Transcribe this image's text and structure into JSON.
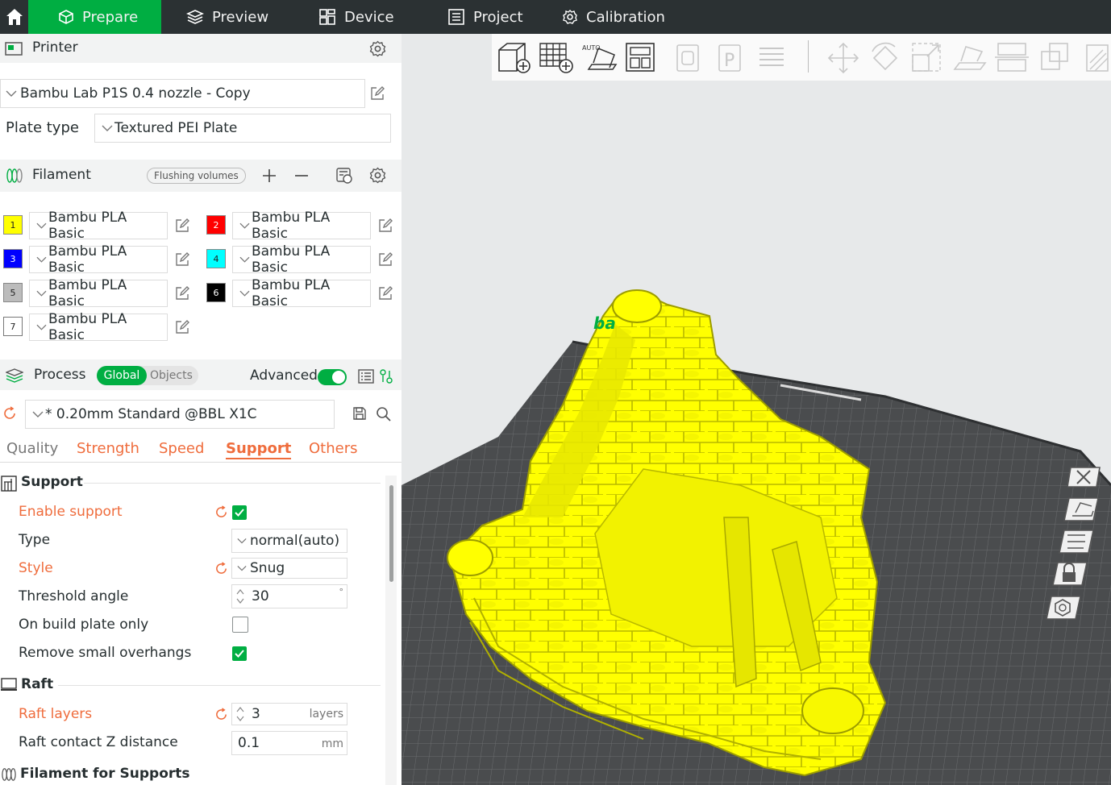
{
  "topbar": {
    "tabs": [
      {
        "label": "Prepare",
        "icon": "cube-icon"
      },
      {
        "label": "Preview",
        "icon": "layers-icon"
      },
      {
        "label": "Device",
        "icon": "device-icon"
      },
      {
        "label": "Project",
        "icon": "project-icon"
      },
      {
        "label": "Calibration",
        "icon": "calibration-icon"
      }
    ],
    "active": "Prepare",
    "accent": "#00ae42",
    "bg": "#2b3133"
  },
  "printer": {
    "title": "Printer",
    "preset": "Bambu Lab P1S 0.4 nozzle - Copy",
    "plate_label": "Plate type",
    "plate_value": "Textured PEI Plate"
  },
  "filament": {
    "title": "Filament",
    "flushing_label": "Flushing volumes",
    "slots": [
      {
        "num": "1",
        "color": "#ffff00",
        "name": "Bambu PLA Basic"
      },
      {
        "num": "2",
        "color": "#ff0000",
        "name": "Bambu PLA Basic"
      },
      {
        "num": "3",
        "color": "#0000ff",
        "name": "Bambu PLA Basic"
      },
      {
        "num": "4",
        "color": "#00ffff",
        "name": "Bambu PLA Basic"
      },
      {
        "num": "5",
        "color": "#bcbcbc",
        "name": "Bambu PLA Basic"
      },
      {
        "num": "6",
        "color": "#000000",
        "name": "Bambu PLA Basic"
      },
      {
        "num": "7",
        "color": "#ffffff",
        "name": "Bambu PLA Basic"
      }
    ]
  },
  "process": {
    "title": "Process",
    "seg_global": "Global",
    "seg_objects": "Objects",
    "advanced_label": "Advanced",
    "advanced_on": true,
    "preset": "* 0.20mm Standard @BBL X1C",
    "tabs": [
      "Quality",
      "Strength",
      "Speed",
      "Support",
      "Others"
    ],
    "active_tab": "Support"
  },
  "support": {
    "title": "Support",
    "enable_label": "Enable support",
    "enable_checked": true,
    "type_label": "Type",
    "type_value": "normal(auto)",
    "style_label": "Style",
    "style_value": "Snug",
    "threshold_label": "Threshold angle",
    "threshold_value": "30",
    "threshold_unit": "°",
    "buildplate_label": "On build plate only",
    "buildplate_checked": false,
    "overhangs_label": "Remove small overhangs",
    "overhangs_checked": true
  },
  "raft": {
    "title": "Raft",
    "layers_label": "Raft layers",
    "layers_value": "3",
    "layers_unit": "layers",
    "contact_label": "Raft contact Z distance",
    "contact_value": "0.1",
    "contact_unit": "mm"
  },
  "filament_supports": {
    "title": "Filament for Supports"
  },
  "viewport": {
    "model_color": "#ffff00",
    "plate_color": "#4a4c4e",
    "brand_text": "ba"
  }
}
